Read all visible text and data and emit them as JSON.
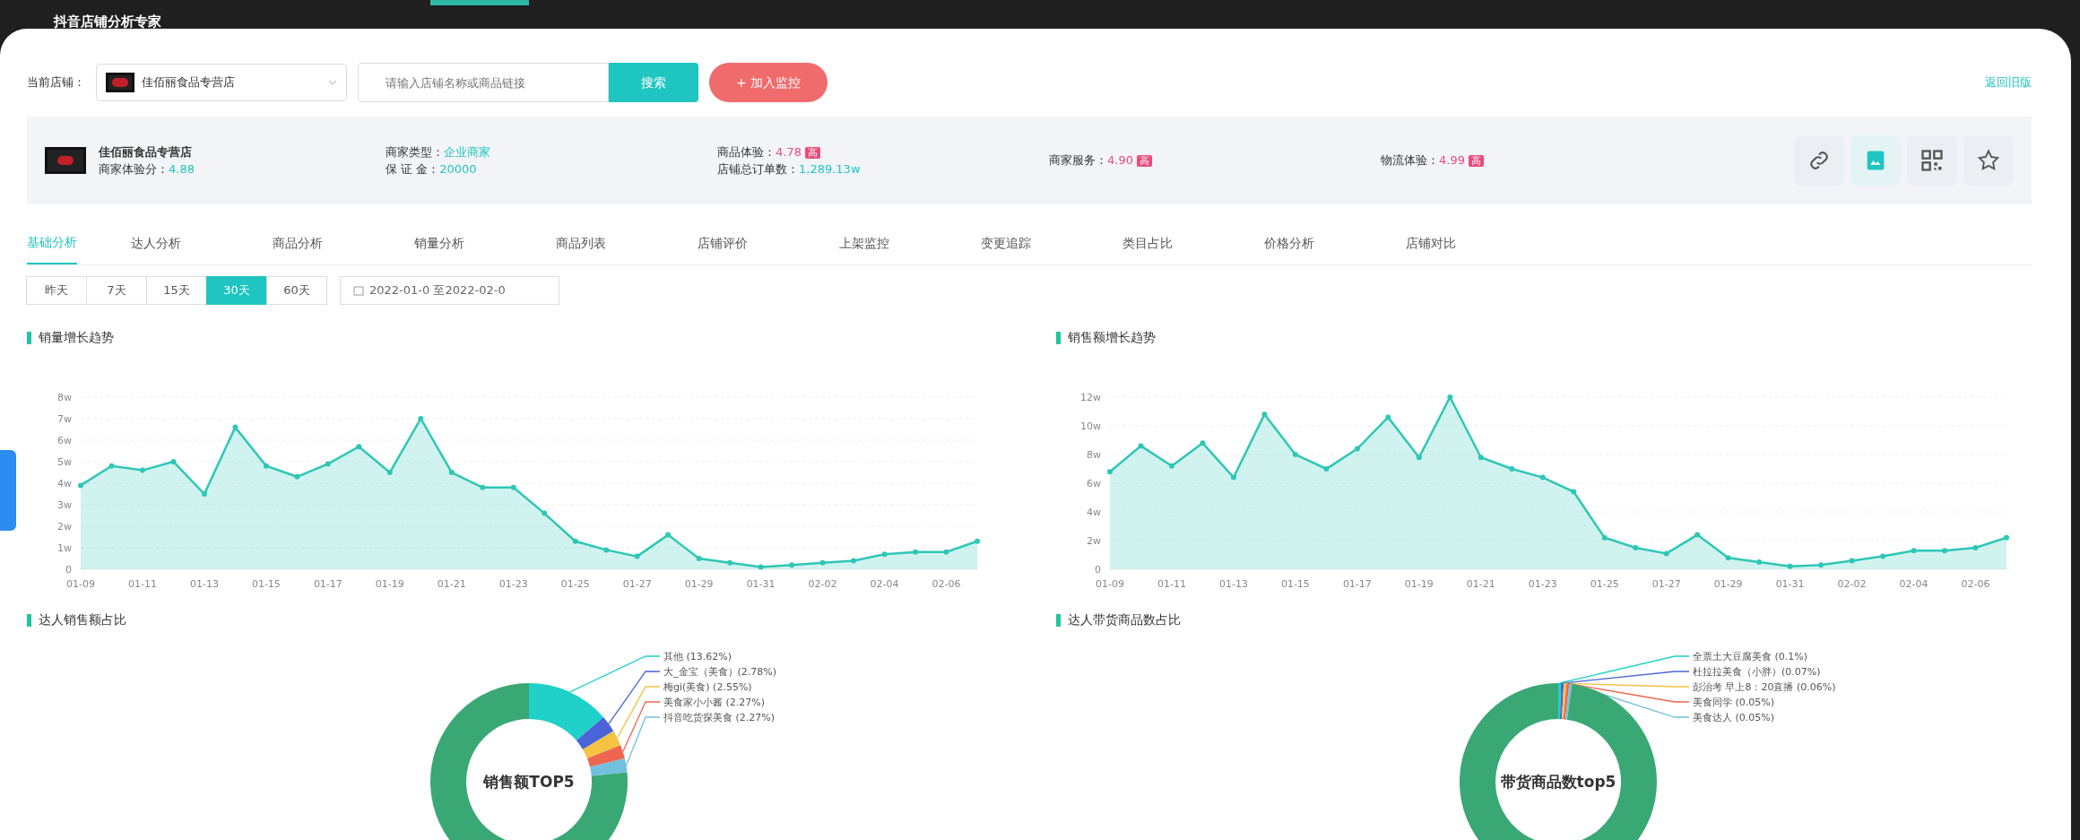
{
  "app_title": "抖音店铺分析专家",
  "search_bar": {
    "store_label": "当前店铺：",
    "store_name": "佳佰丽食品专营店",
    "placeholder": "请输入店铺名称或商品链接",
    "search_button": "搜索",
    "monitor_button": "+ 加入监控",
    "back_link": "返回旧版"
  },
  "store_info": {
    "name": "佳佰丽食品专营店",
    "stats": [
      {
        "label": "商家体验分：",
        "value": "4.88"
      },
      {
        "label": "商家类型：",
        "value": "企业商家"
      },
      {
        "label": "保 证 金：",
        "value": "20000"
      },
      {
        "label": "商品体验：",
        "value": "4.78",
        "badge": "高"
      },
      {
        "label": "店铺总订单数：",
        "value": "1,289.13w"
      },
      {
        "label": "商家服务：",
        "value": "4.90",
        "badge": "高"
      },
      {
        "label": "物流体验：",
        "value": "4.99",
        "badge": "高"
      }
    ]
  },
  "tabs": [
    {
      "label": "基础分析",
      "selected": true
    },
    {
      "label": "达人分析",
      "selected": false
    },
    {
      "label": "商品分析",
      "selected": false
    },
    {
      "label": "销量分析",
      "selected": false
    },
    {
      "label": "商品列表",
      "selected": false
    },
    {
      "label": "店铺评价",
      "selected": false
    },
    {
      "label": "上架监控",
      "selected": false
    },
    {
      "label": "变更追踪",
      "selected": false
    },
    {
      "label": "类目占比",
      "selected": false
    },
    {
      "label": "价格分析",
      "selected": false
    },
    {
      "label": "店铺对比",
      "selected": false
    }
  ],
  "periods": [
    {
      "label": "昨天",
      "selected": false
    },
    {
      "label": "7天",
      "selected": false
    },
    {
      "label": "15天",
      "selected": false
    },
    {
      "label": "30天",
      "selected": true
    },
    {
      "label": "60天",
      "selected": false
    }
  ],
  "date_range": "2022-01-0 至2022-02-0",
  "line_charts": [
    {
      "title": "销量增长趋势",
      "chart_data": {
        "type": "area",
        "categories": [
          "01-09",
          null,
          "01-11",
          null,
          "01-13",
          null,
          "01-15",
          null,
          "01-17",
          null,
          "01-19",
          null,
          "01-21",
          null,
          "01-23",
          null,
          "01-25",
          null,
          "01-27",
          null,
          "01-29",
          null,
          "01-31",
          null,
          "02-02",
          null,
          "02-04",
          null,
          "02-06",
          null
        ],
        "series": [
          {
            "color": "#2ec7b5",
            "values": [
              3.9,
              4.8,
              4.6,
              5.0,
              3.5,
              6.6,
              4.8,
              4.3,
              4.9,
              5.7,
              4.5,
              7.0,
              4.5,
              3.8,
              3.8,
              2.6,
              1.3,
              0.9,
              0.6,
              1.6,
              0.5,
              0.3,
              0.1,
              0.2,
              0.3,
              0.4,
              0.7,
              0.8,
              0.8,
              1.3
            ]
          }
        ],
        "grid": true,
        "ylim": [
          0,
          8
        ],
        "yticks": [
          {
            "value": 0,
            "label": "0"
          },
          {
            "value": 1,
            "label": "1w"
          },
          {
            "value": 2,
            "label": "2w"
          },
          {
            "value": 3,
            "label": "3w"
          },
          {
            "value": 4,
            "label": "4w"
          },
          {
            "value": 5,
            "label": "5w"
          },
          {
            "value": 6,
            "label": "6w"
          },
          {
            "value": 7,
            "label": "7w"
          },
          {
            "value": 8,
            "label": "8w"
          }
        ]
      }
    },
    {
      "title": "销售额增长趋势",
      "chart_data": {
        "type": "area",
        "categories": [
          "01-09",
          null,
          "01-11",
          null,
          "01-13",
          null,
          "01-15",
          null,
          "01-17",
          null,
          "01-19",
          null,
          "01-21",
          null,
          "01-23",
          null,
          "01-25",
          null,
          "01-27",
          null,
          "01-29",
          null,
          "01-31",
          null,
          "02-02",
          null,
          "02-04",
          null,
          "02-06",
          null
        ],
        "series": [
          {
            "color": "#2ec7b5",
            "values": [
              6.8,
              8.6,
              7.2,
              8.8,
              6.4,
              10.8,
              8.0,
              7.0,
              8.4,
              10.6,
              7.8,
              12.0,
              7.8,
              7.0,
              6.4,
              5.4,
              2.2,
              1.5,
              1.1,
              2.4,
              0.8,
              0.5,
              0.2,
              0.3,
              0.6,
              0.9,
              1.3,
              1.3,
              1.5,
              2.2
            ]
          }
        ],
        "grid": true,
        "ylim": [
          0,
          12
        ],
        "yticks": [
          {
            "value": 0,
            "label": "0"
          },
          {
            "value": 2,
            "label": "2w"
          },
          {
            "value": 4,
            "label": "4w"
          },
          {
            "value": 6,
            "label": "6w"
          },
          {
            "value": 8,
            "label": "8w"
          },
          {
            "value": 10,
            "label": "10w"
          },
          {
            "value": 12,
            "label": "12w"
          }
        ]
      }
    }
  ],
  "donut_charts": [
    {
      "title": "达人销售额占比",
      "center_text": "销售额TOP5",
      "chart_data": {
        "type": "donut",
        "categories": [
          "其他 (13.62%)",
          "大_金宝（美食）(2.78%)",
          "梅gi(美食) (2.55%)",
          "美食家小小酱 (2.27%)",
          "抖音吃货探美食 (2.27%)",
          null
        ],
        "series": [
          {
            "values": [
              13.62,
              2.78,
              2.55,
              2.27,
              2.27,
              76.51
            ]
          }
        ],
        "colors": [
          "#1fd1c9",
          "#4a63d8",
          "#f5c242",
          "#ee6650",
          "#73c0de",
          "#3aa874"
        ]
      }
    },
    {
      "title": "达人带货商品数占比",
      "center_text": "带货商品数top5",
      "slices": [
        {
          "label": "全票土大豆腐美食 (0.1%)",
          "color": "#1fd1c9"
        },
        {
          "label": "杜拉拉美食（小胖）(0.07%)",
          "color": "#4a63d8"
        },
        {
          "label": "彭治考 早上8：20直播 (0.06%)",
          "color": "#f5c242"
        },
        {
          "label": "美食同学 (0.05%)",
          "color": "#ee6650"
        },
        {
          "label": "美食达人 (0.05%)",
          "color": "#73c0de"
        }
      ]
    }
  ]
}
